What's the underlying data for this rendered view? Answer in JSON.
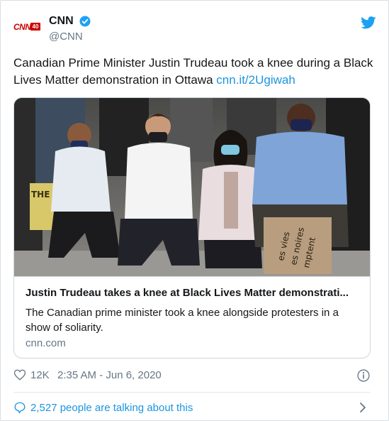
{
  "author": {
    "logo_text": "CNN",
    "logo_badge": "40",
    "name": "CNN",
    "handle": "@CNN"
  },
  "tweet": {
    "text": "Canadian Prime Minister Justin Trudeau took a knee during a Black Lives Matter demonstration in Ottawa ",
    "link": "cnn.it/2Ugiwah"
  },
  "card": {
    "title": "Justin Trudeau takes a knee at Black Lives Matter demonstrati...",
    "description": "The Canadian prime minister took a knee alongside protesters in a show of soliarity.",
    "domain": "cnn.com",
    "sign_text": "es vies\nes noires\nmptent",
    "left_sign_text": "THE"
  },
  "meta": {
    "likes": "12K",
    "timestamp": "2:35 AM - Jun 6, 2020"
  },
  "conversation": {
    "text": "2,527 people are talking about this"
  },
  "colors": {
    "brand_blue": "#1da1f2",
    "link_blue": "#1b95e0",
    "cnn_red": "#cc0000",
    "muted": "#657786"
  },
  "icons": {
    "verified": "verified-badge-icon",
    "twitter": "twitter-bird-icon",
    "like": "heart-icon",
    "info": "info-icon",
    "conversation": "speech-bubble-icon",
    "chevron": "chevron-right-icon"
  }
}
